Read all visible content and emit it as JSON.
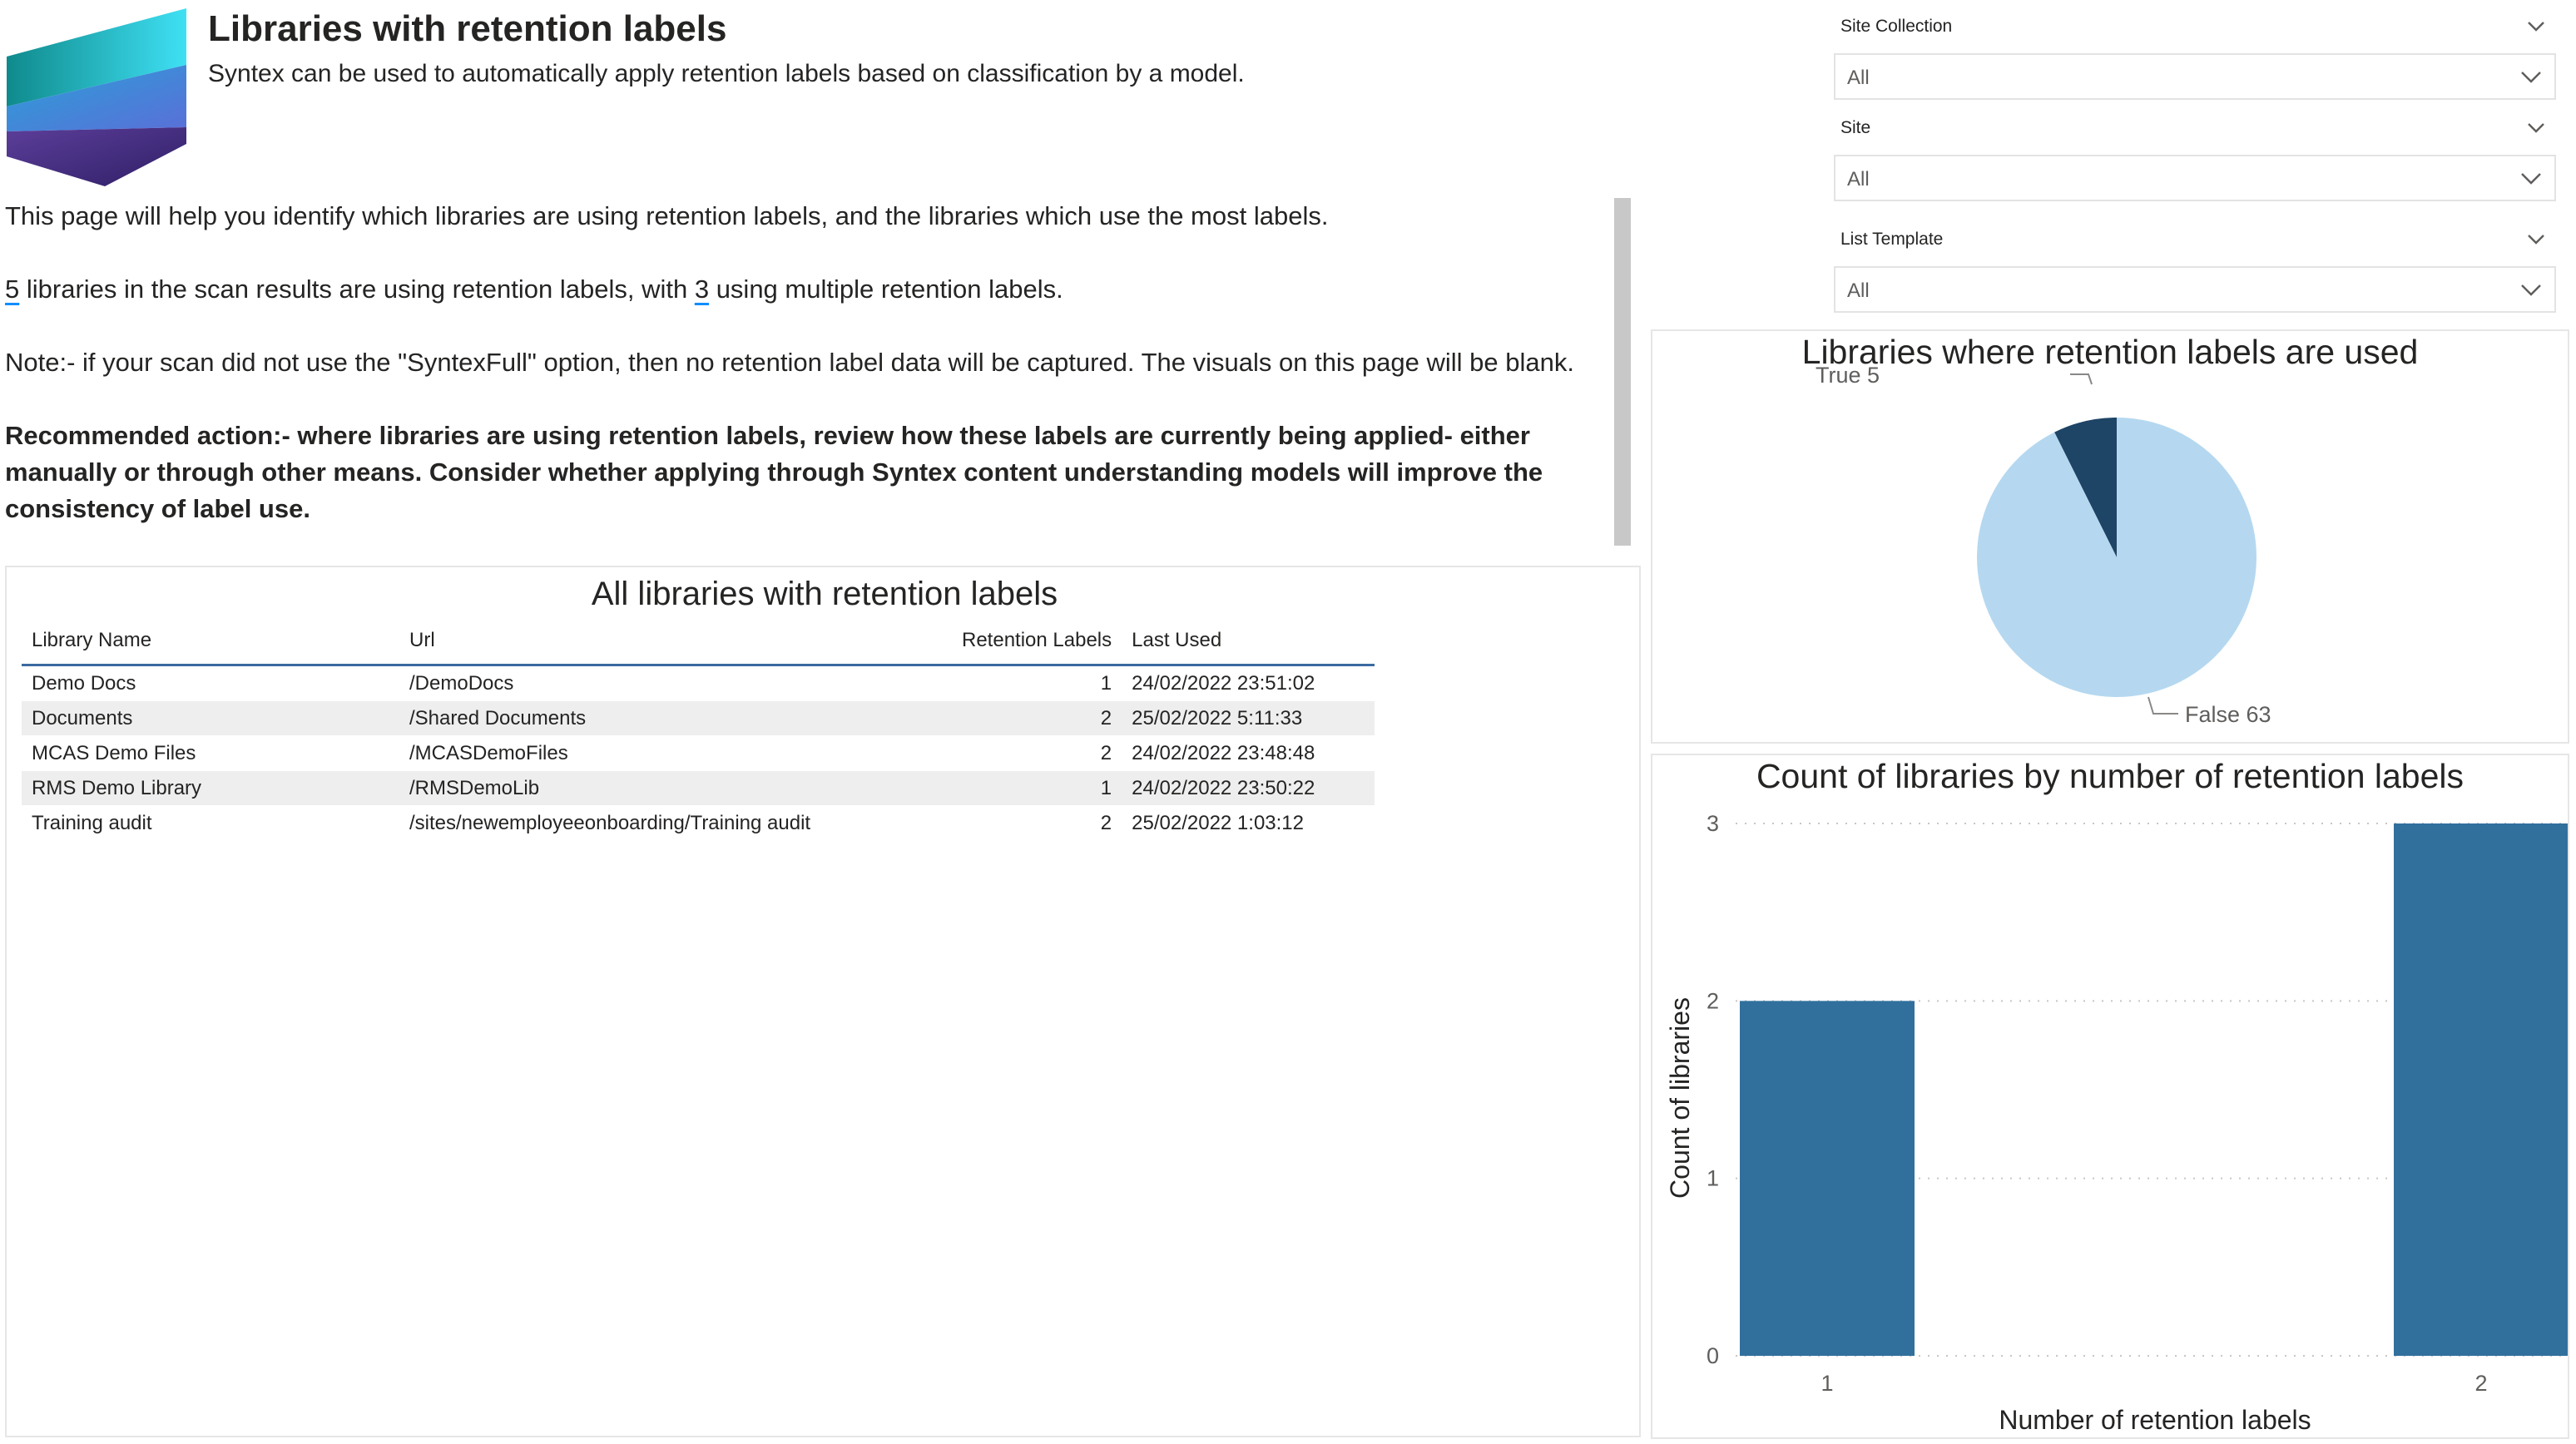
{
  "header": {
    "title": "Libraries with retention labels",
    "subtitle": "Syntex can be used to automatically apply retention labels based on classification by a model."
  },
  "textbox": {
    "intro": "This page will help you identify which libraries are using retention labels, and the libraries which use the most labels.",
    "summary_count": "5",
    "summary_mid": " libraries in the scan results are using retention labels, with ",
    "summary_multi": "3",
    "summary_end": " using multiple retention labels.",
    "note": "Note:- if your scan did not use the \"SyntexFull\" option, then no retention label data will be captured. The visuals on this page will be blank.",
    "recommendation": "Recommended action:- where libraries are using retention labels, review how these labels are currently being applied- either manually or through other means. Consider whether applying through Syntex content understanding models will improve the consistency of label use."
  },
  "table": {
    "title": "All libraries with retention labels",
    "columns": [
      "Library Name",
      "Url",
      "Retention Labels",
      "Last Used"
    ],
    "rows": [
      [
        "Demo Docs",
        "/DemoDocs",
        "1",
        "24/02/2022 23:51:02"
      ],
      [
        "Documents",
        "/Shared Documents",
        "2",
        "25/02/2022 5:11:33"
      ],
      [
        "MCAS Demo Files",
        "/MCASDemoFiles",
        "2",
        "24/02/2022 23:48:48"
      ],
      [
        "RMS Demo Library",
        "/RMSDemoLib",
        "1",
        "24/02/2022 23:50:22"
      ],
      [
        "Training audit",
        "/sites/newemployeeonboarding/Training audit",
        "2",
        "25/02/2022 1:03:12"
      ]
    ]
  },
  "slicers": [
    {
      "label": "Site Collection",
      "value": "All"
    },
    {
      "label": "Site",
      "value": "All"
    },
    {
      "label": "List Template",
      "value": "All"
    }
  ],
  "icons": {
    "logo": "syntex-logo",
    "slicer_chevron": "chevron-down-icon"
  },
  "colors": {
    "pie_true": "#1e4466",
    "pie_false": "#b5d8f0",
    "bar": "#31709d",
    "table_header_rule": "#3b6aa0"
  },
  "chart_data": [
    {
      "type": "pie",
      "title": "Libraries where retention labels are used",
      "slices": [
        {
          "label": "True",
          "value": 5
        },
        {
          "label": "False",
          "value": 63
        }
      ]
    },
    {
      "type": "bar",
      "title": "Count of libraries by number of retention labels",
      "categories": [
        "1",
        "2"
      ],
      "values": [
        2,
        3
      ],
      "xlabel": "Number of retention labels",
      "ylabel": "Count of libraries",
      "ylim": [
        0,
        3
      ],
      "yticks": [
        "0",
        "1",
        "2",
        "3"
      ],
      "grid": true
    }
  ]
}
